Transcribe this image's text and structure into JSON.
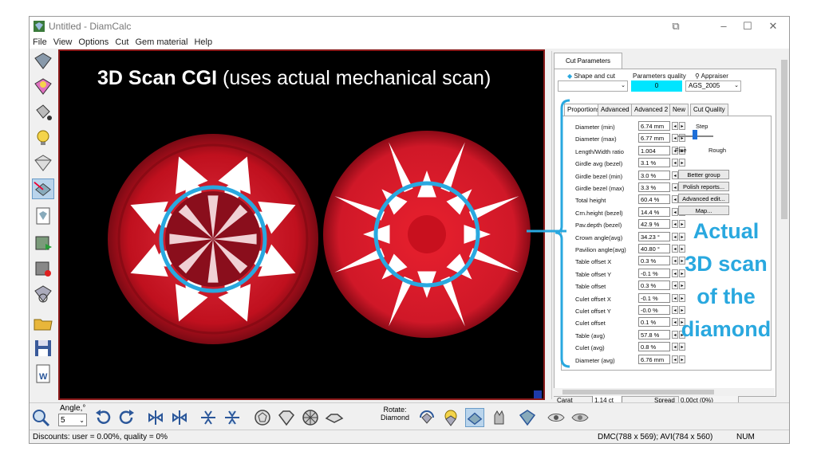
{
  "window": {
    "title": "Untitled - DiamCalc"
  },
  "menu": [
    "File",
    "View",
    "Options",
    "Cut",
    "Gem material",
    "Help"
  ],
  "overlay": {
    "bold": "3D Scan CGI",
    "rest": " (uses actual mechanical scan)"
  },
  "panel": {
    "tab": "Cut Parameters",
    "shape_label": "Shape and cut",
    "quality_label": "Parameters quality",
    "quality_value": "0",
    "appraiser_label": "Appraiser",
    "appraiser_value": "AGS_2005",
    "subtabs": [
      "Proportions",
      "Advanced",
      "Advanced 2",
      "New",
      "Cut Quality"
    ],
    "step_label": "Step",
    "fine_label": "Fine",
    "rough_label": "Rough",
    "buttons": [
      "Better group",
      "Polish reports...",
      "Advanced edit...",
      "Map..."
    ],
    "rows": [
      {
        "label": "Diameter (min)",
        "value": "6.74 mm"
      },
      {
        "label": "Diameter (max)",
        "value": "6.77 mm"
      },
      {
        "label": "Length/Width ratio",
        "value": "1.004"
      },
      {
        "label": "Girdle avg (bezel)",
        "value": "3.1 %"
      },
      {
        "label": "Girdle bezel (min)",
        "value": "3.0 %"
      },
      {
        "label": "Girdle bezel (max)",
        "value": "3.3 %"
      },
      {
        "label": "Total height",
        "value": "60.4 %"
      },
      {
        "label": "Crn.height (bezel)",
        "value": "14.4 %"
      },
      {
        "label": "Pav.depth (bezel)",
        "value": "42.9 %"
      },
      {
        "label": "Crown angle(avg)",
        "value": "34.23 °"
      },
      {
        "label": "Pavilion angle(avg)",
        "value": "40.80 °"
      },
      {
        "label": "Table offset X",
        "value": "0.3 %"
      },
      {
        "label": "Table offset Y",
        "value": "-0.1 %"
      },
      {
        "label": "Table offset",
        "value": "0.3 %"
      },
      {
        "label": "Culet offset X",
        "value": "-0.1 %"
      },
      {
        "label": "Culet offset Y",
        "value": "-0.0 %"
      },
      {
        "label": "Culet offset",
        "value": "0.1 %"
      },
      {
        "label": "Table (avg)",
        "value": "57.8 %"
      },
      {
        "label": "Culet (avg)",
        "value": "0.8 %"
      },
      {
        "label": "Diameter (avg)",
        "value": "6.76 mm"
      }
    ],
    "carat_label": "Carat weight",
    "carat_value": "1.14 ct",
    "spread_label": "Spread",
    "spread_value": "0.00ct (0%)"
  },
  "bottom": {
    "angle_label": "Angle,°",
    "angle_value": "5",
    "rotate_label": "Rotate:",
    "rotate_value": "Diamond"
  },
  "status": {
    "discounts": "Discounts: user = 0.00%, quality = 0%",
    "dims": "DMC(788 x 569); AVI(784 x 560)",
    "num": "NUM"
  },
  "annotation": [
    "Actual",
    "3D scan",
    "of the",
    "diamond"
  ],
  "colors": {
    "accent": "#29a8df",
    "gem_red": "#c8102e",
    "quality_bg": "#00e5ff"
  }
}
